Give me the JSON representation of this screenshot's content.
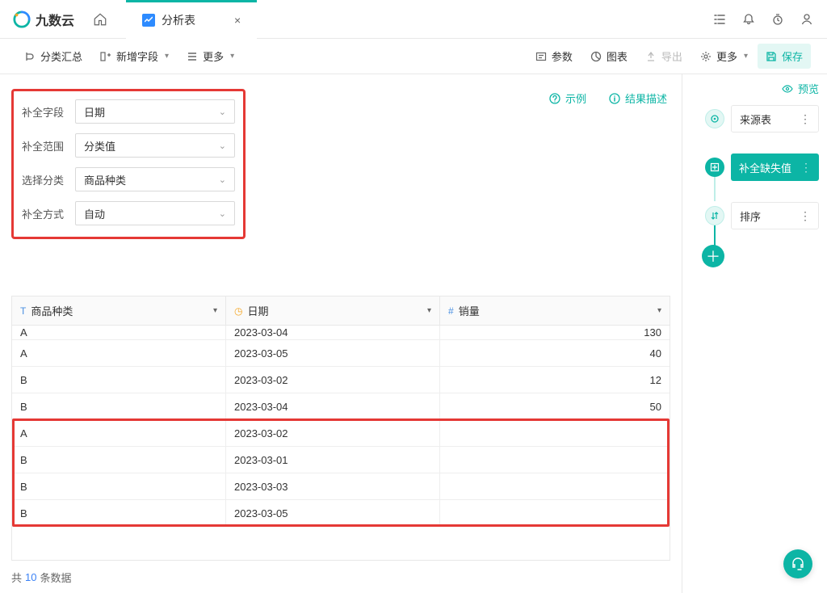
{
  "app": {
    "name": "九数云"
  },
  "tab": {
    "title": "分析表"
  },
  "toolbar": {
    "group_summary": "分类汇总",
    "add_field": "新增字段",
    "more_left": "更多",
    "params": "参数",
    "chart": "图表",
    "export": "导出",
    "more_right": "更多",
    "save": "保存"
  },
  "links": {
    "example": "示例",
    "result_desc": "结果描述"
  },
  "config": {
    "field_label": "补全字段",
    "field_value": "日期",
    "range_label": "补全范围",
    "range_value": "分类值",
    "class_label": "选择分类",
    "class_value": "商品种类",
    "method_label": "补全方式",
    "method_value": "自动"
  },
  "columns": [
    {
      "name": "商品种类",
      "type": "T"
    },
    {
      "name": "日期",
      "type": "date"
    },
    {
      "name": "销量",
      "type": "num"
    }
  ],
  "rows": [
    {
      "c1": "A",
      "c2": "2023-03-04",
      "c3": "130",
      "cut": true
    },
    {
      "c1": "A",
      "c2": "2023-03-05",
      "c3": "40"
    },
    {
      "c1": "B",
      "c2": "2023-03-02",
      "c3": "12"
    },
    {
      "c1": "B",
      "c2": "2023-03-04",
      "c3": "50"
    },
    {
      "c1": "A",
      "c2": "2023-03-02",
      "c3": ""
    },
    {
      "c1": "B",
      "c2": "2023-03-01",
      "c3": ""
    },
    {
      "c1": "B",
      "c2": "2023-03-03",
      "c3": ""
    },
    {
      "c1": "B",
      "c2": "2023-03-05",
      "c3": ""
    }
  ],
  "footer": {
    "prefix": "共",
    "count": "10",
    "suffix": "条数据"
  },
  "sidebar": {
    "preview": "预览",
    "steps": [
      {
        "label": "来源表",
        "state": "normal",
        "icon": "target"
      },
      {
        "label": "补全缺失值",
        "state": "active",
        "icon": "fill"
      },
      {
        "label": "排序",
        "state": "normal",
        "icon": "sort"
      }
    ]
  }
}
